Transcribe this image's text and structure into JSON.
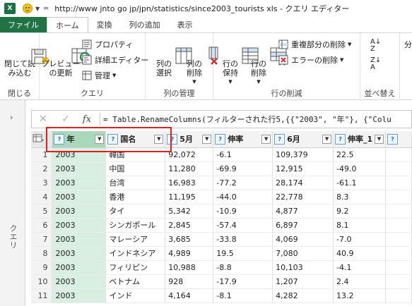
{
  "titlebar": {
    "app_logo": "X",
    "title": "http://www jnto go jp/jpn/statistics/since2003_tourists xls - クエリ エディター"
  },
  "tabs": [
    "ファイル",
    "ホーム",
    "変換",
    "列の追加",
    "表示"
  ],
  "ribbon": {
    "close_group": {
      "label": "閉じる",
      "button": "閉じて読\nみ込む"
    },
    "query_group": {
      "label": "クエリ",
      "preview_button": "プレビュー\nの更新",
      "properties": "プロパティ",
      "advanced_editor": "詳細エディター",
      "manage": "管理"
    },
    "columns_group": {
      "label": "列の管理",
      "select": "列の\n選択",
      "remove": "列の\n削除"
    },
    "rows_group": {
      "label": "行の削減",
      "keep": "行の\n保持",
      "remove": "行の\n削除",
      "remove_duplicates": "重複部分の削除",
      "remove_errors": "エラーの削除"
    },
    "sort_group": {
      "label": "並べ替え"
    },
    "extra_label": "分"
  },
  "sidebar": {
    "label": "クエリ"
  },
  "formula_bar": {
    "fx": "fx",
    "formula": "= Table.RenameColumns(フィルターされた行5,{{\"2003\", \"年\"}, {\"Colu"
  },
  "grid": {
    "columns": [
      {
        "name": "年",
        "type": "ABC\n123"
      },
      {
        "name": "国名",
        "type": "ABC\n123"
      },
      {
        "name": "5月",
        "type": "ABC\n123"
      },
      {
        "name": "伸率",
        "type": "ABC\n123"
      },
      {
        "name": "6月",
        "type": "ABC\n123"
      },
      {
        "name": "伸率_1",
        "type": "ABC\n123"
      }
    ],
    "rows": [
      [
        "1",
        "2003",
        "韓国",
        "92,072",
        "-6.1",
        "109,379",
        "22.5"
      ],
      [
        "2",
        "2003",
        "中国",
        "11,280",
        "-69.9",
        "12,915",
        "-49.0"
      ],
      [
        "3",
        "2003",
        "台湾",
        "16,983",
        "-77.2",
        "28,174",
        "-61.1"
      ],
      [
        "4",
        "2003",
        "香港",
        "11,195",
        "-44.0",
        "22,778",
        "8.3"
      ],
      [
        "5",
        "2003",
        "タイ",
        "5,342",
        "-10.9",
        "4,877",
        "9.2"
      ],
      [
        "6",
        "2003",
        "シンガポール",
        "2,845",
        "-57.4",
        "6,897",
        "8.1"
      ],
      [
        "7",
        "2003",
        "マレーシア",
        "3,685",
        "-33.8",
        "4,069",
        "-7.0"
      ],
      [
        "8",
        "2003",
        "インドネシア",
        "4,989",
        "19.5",
        "7,080",
        "40.9"
      ],
      [
        "9",
        "2003",
        "フィリピン",
        "10,988",
        "-8.8",
        "10,103",
        "-4.1"
      ],
      [
        "10",
        "2003",
        "ベトナム",
        "928",
        "-17.9",
        "1,207",
        "2.4"
      ],
      [
        "11",
        "2003",
        "インド",
        "4,164",
        "-8.1",
        "4,282",
        "13.2"
      ]
    ]
  }
}
